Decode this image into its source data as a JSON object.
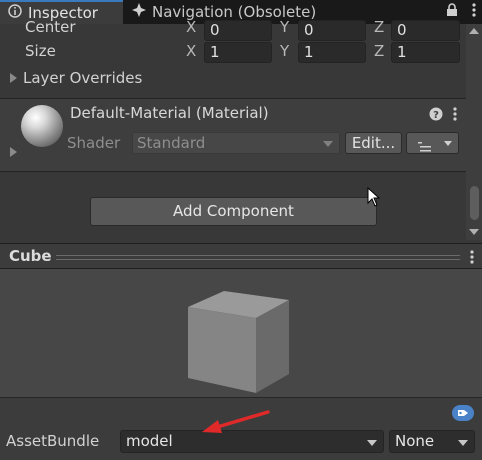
{
  "tabs": {
    "inspector": "Inspector",
    "navigation": "Navigation (Obsolete)"
  },
  "transform": {
    "center_label": "Center",
    "center": {
      "x": "0",
      "y": "0",
      "z": "0"
    },
    "size_label": "Size",
    "size": {
      "x": "1",
      "y": "1",
      "z": "1"
    },
    "axis_x": "X",
    "axis_y": "Y",
    "axis_z": "Z"
  },
  "layer_overrides_label": "Layer Overrides",
  "material": {
    "title": "Default-Material (Material)",
    "shader_label": "Shader",
    "shader_value": "Standard",
    "edit_label": "Edit..."
  },
  "add_component_label": "Add Component",
  "preview": {
    "title": "Cube"
  },
  "asset_bundle": {
    "label": "AssetBundle",
    "value": "model",
    "variant": "None"
  },
  "colors": {
    "accent": "#3a79bb",
    "annotation_arrow": "#e02a2a",
    "tag_icon": "#4a82c8"
  }
}
